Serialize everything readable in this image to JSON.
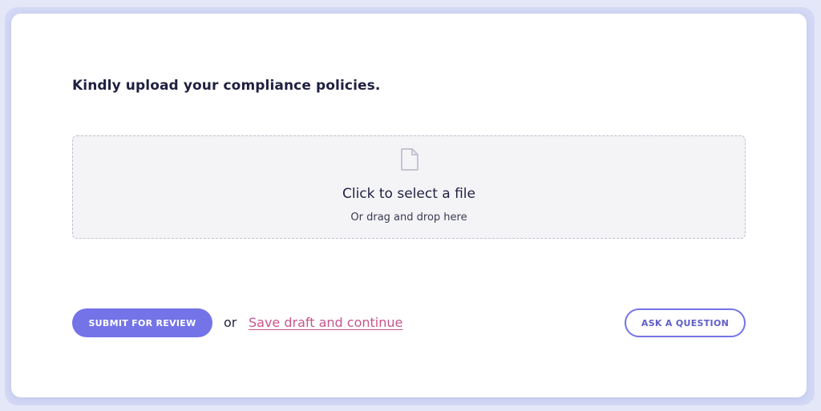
{
  "form": {
    "question": "Kindly upload your compliance policies."
  },
  "dropzone": {
    "title": "Click to select a file",
    "subtitle": "Or drag and drop here",
    "icon": "file-icon"
  },
  "actions": {
    "submit_label": "SUBMIT FOR REVIEW",
    "or_text": "or",
    "save_draft_label": "Save draft and continue",
    "ask_label": "ASK A QUESTION"
  },
  "colors": {
    "primary": "#7473e8",
    "link": "#c8558c",
    "text": "#1f2041",
    "dropzone_bg": "#f4f4f7"
  }
}
